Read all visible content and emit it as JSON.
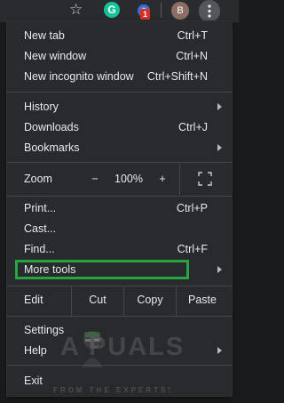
{
  "toolbar": {
    "icons": [
      "star-icon",
      "grammarly-icon",
      "extension-icon",
      "profile-avatar",
      "kebab-menu-icon"
    ],
    "grammarly_letter": "G",
    "extension_badge": "1",
    "avatar_initial": "B"
  },
  "menu": {
    "new_tab": {
      "label": "New tab",
      "shortcut": "Ctrl+T"
    },
    "new_window": {
      "label": "New window",
      "shortcut": "Ctrl+N"
    },
    "new_incognito": {
      "label": "New incognito window",
      "shortcut": "Ctrl+Shift+N"
    },
    "history": {
      "label": "History"
    },
    "downloads": {
      "label": "Downloads",
      "shortcut": "Ctrl+J"
    },
    "bookmarks": {
      "label": "Bookmarks"
    },
    "zoom": {
      "label": "Zoom",
      "minus": "−",
      "value": "100%",
      "plus": "+"
    },
    "print": {
      "label": "Print...",
      "shortcut": "Ctrl+P"
    },
    "cast": {
      "label": "Cast..."
    },
    "find": {
      "label": "Find...",
      "shortcut": "Ctrl+F"
    },
    "more_tools": {
      "label": "More tools"
    },
    "edit": {
      "label": "Edit",
      "cut": "Cut",
      "copy": "Copy",
      "paste": "Paste"
    },
    "settings": {
      "label": "Settings"
    },
    "help": {
      "label": "Help"
    },
    "exit": {
      "label": "Exit"
    }
  },
  "highlight": {
    "target": "More tools",
    "color": "#25a43f"
  },
  "watermark": {
    "text": "A PUALS",
    "tagline": "FROM THE EXPERTS!"
  },
  "colors": {
    "menu_bg": "#292a2d",
    "text": "#e8eaed",
    "separator": "#45464a",
    "highlight": "#25a43f"
  }
}
